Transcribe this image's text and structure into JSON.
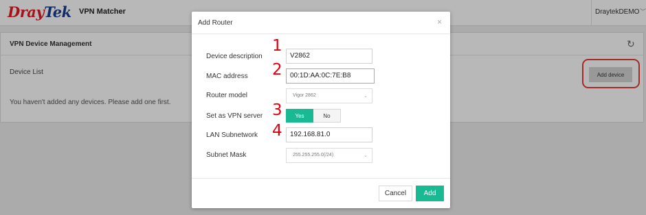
{
  "header": {
    "logo": {
      "part1": "Dray",
      "part2": "Tek"
    },
    "app_title": "VPN Matcher",
    "user": "DraytekDEMO"
  },
  "panel": {
    "title": "VPN Device Management",
    "device_list_label": "Device List",
    "empty_message": "You haven't added any devices. Please add one first.",
    "add_device_label": "Add device"
  },
  "modal": {
    "title": "Add Router",
    "close": "×",
    "fields": {
      "description": {
        "label": "Device description",
        "value": "V2862"
      },
      "mac": {
        "label": "MAC address",
        "value": "00:1D:AA:0C:7E:B8"
      },
      "model": {
        "label": "Router model",
        "value": "Vigor 2862"
      },
      "vpn_server": {
        "label": "Set as VPN server",
        "yes": "Yes",
        "no": "No",
        "selected": "Yes"
      },
      "lan": {
        "label": "LAN Subnetwork",
        "value": "192.168.81.0"
      },
      "mask": {
        "label": "Subnet Mask",
        "value": "255.255.255.0(/24)"
      }
    },
    "cancel_label": "Cancel",
    "add_label": "Add"
  },
  "annotations": [
    "1",
    "2",
    "3",
    "4"
  ],
  "icons": {
    "refresh": "refresh-icon",
    "close": "close-icon",
    "dropdown": "chevron-down-icon"
  },
  "colors": {
    "accent": "#19b994",
    "brand_red": "#e31b23",
    "brand_blue": "#1a3d8f",
    "annotation": "#e0000f"
  }
}
